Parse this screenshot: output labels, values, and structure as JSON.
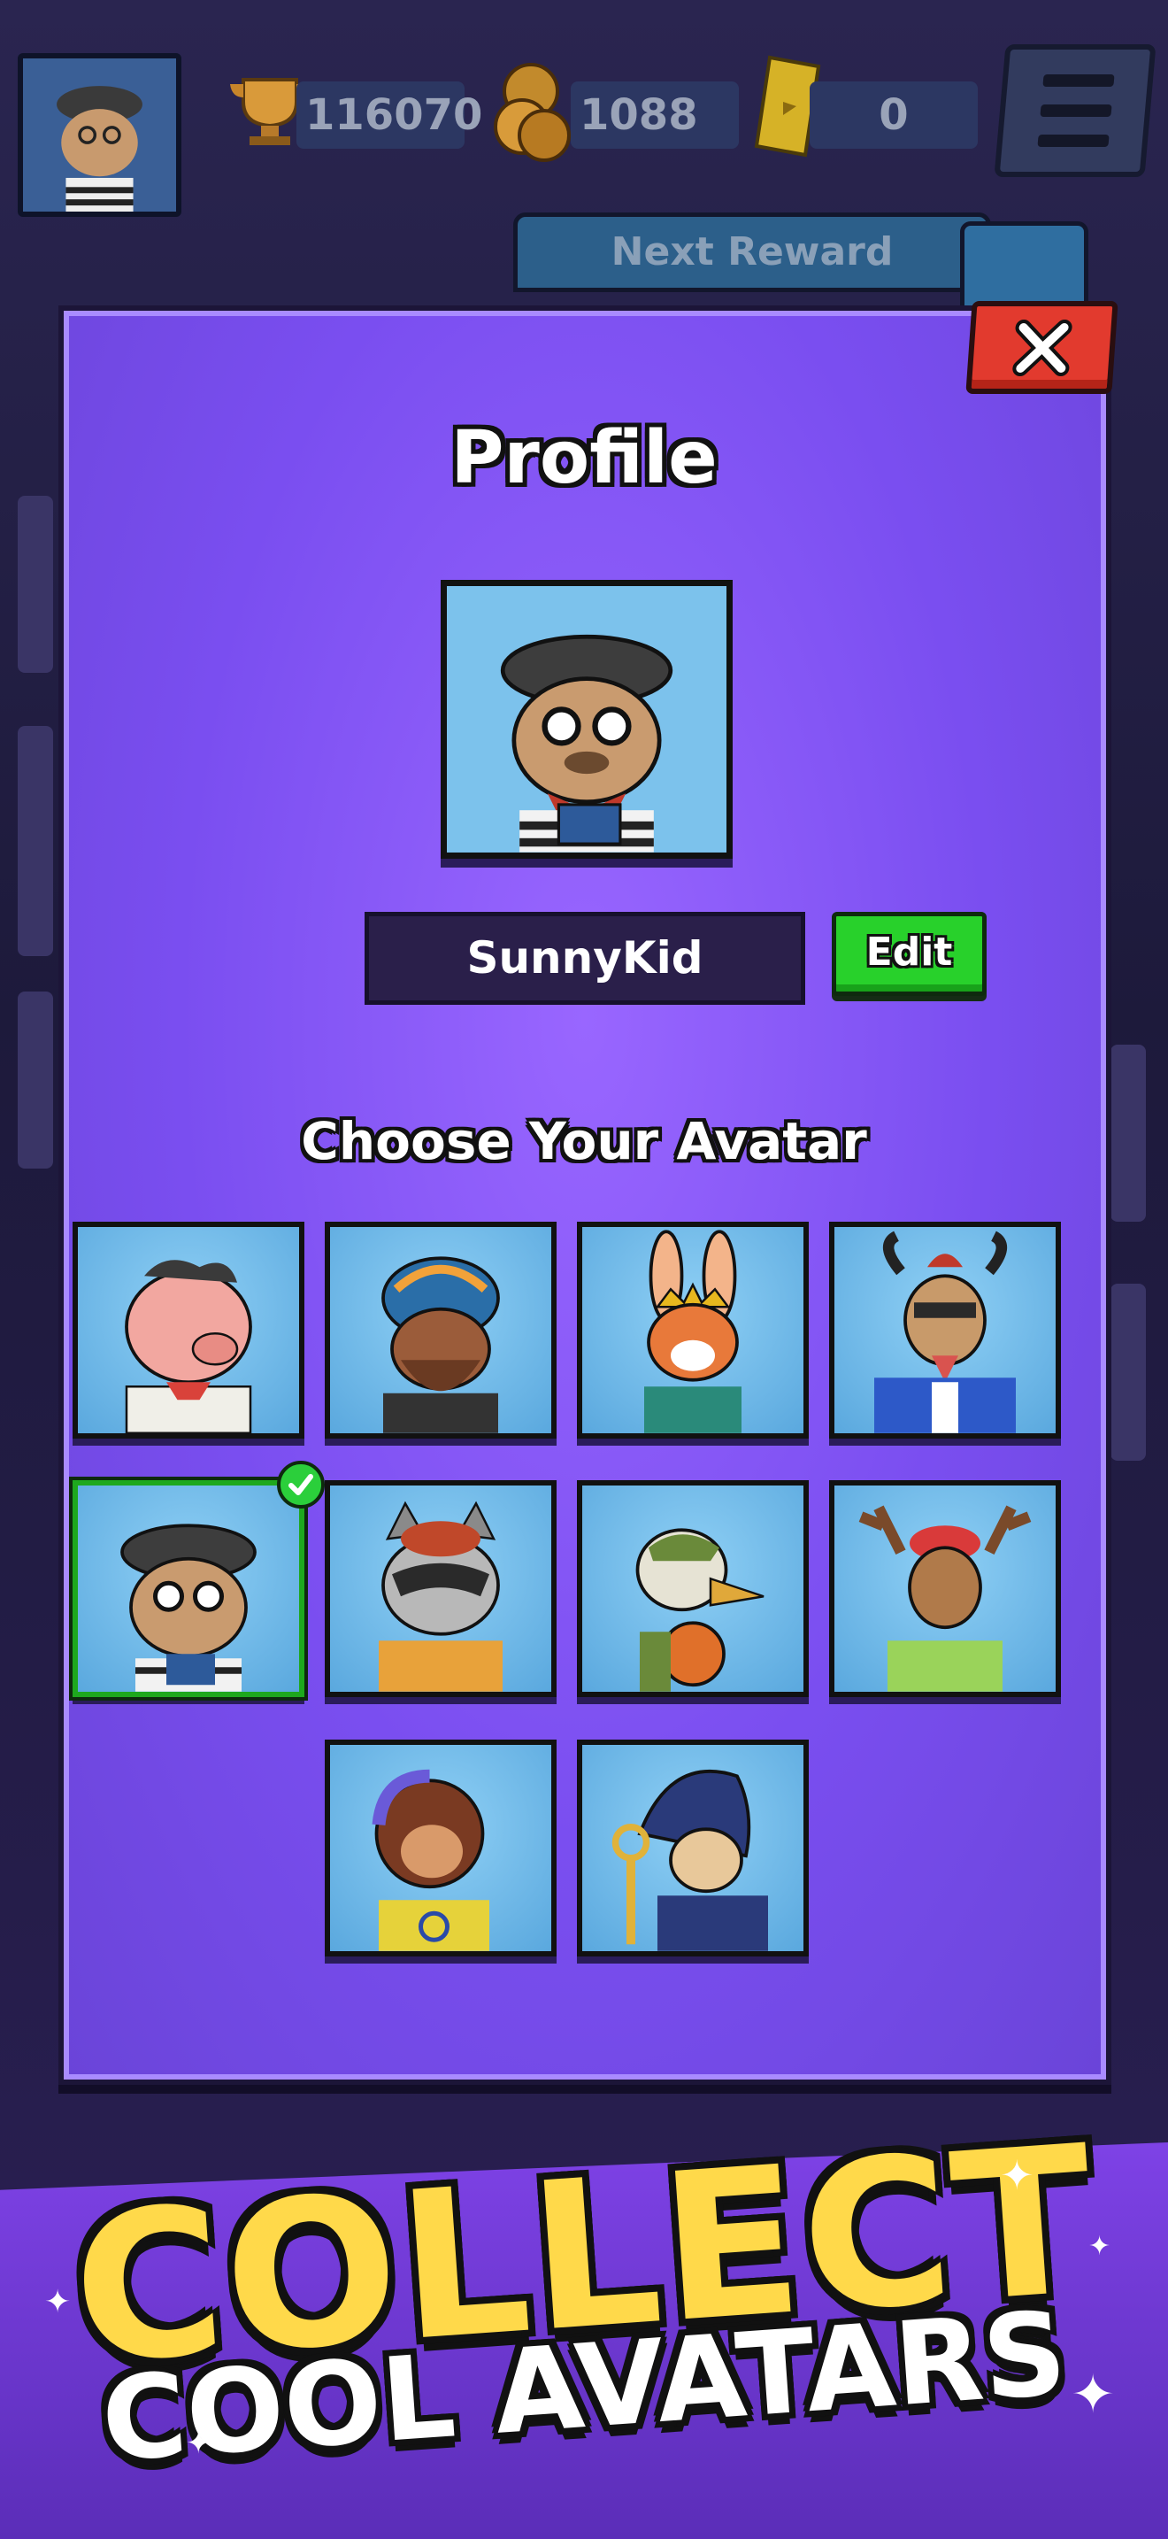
{
  "hud": {
    "trophies": "116070",
    "coins": "1088",
    "tickets": "0",
    "next_reward_label": "Next Reward"
  },
  "dialog": {
    "title": "Profile",
    "player_name": "SunnyKid",
    "edit_label": "Edit",
    "avatar_section_title": "Choose Your Avatar"
  },
  "avatars": [
    {
      "name": "pig",
      "icon": "pig-avatar-icon",
      "selected": false
    },
    {
      "name": "beaver-biker",
      "icon": "beaver-avatar-icon",
      "selected": false
    },
    {
      "name": "bunny-king",
      "icon": "bunny-avatar-icon",
      "selected": false
    },
    {
      "name": "goat-cool",
      "icon": "goat-avatar-icon",
      "selected": false
    },
    {
      "name": "bulldog",
      "icon": "bulldog-avatar-icon",
      "selected": true
    },
    {
      "name": "raccoon",
      "icon": "raccoon-avatar-icon",
      "selected": false
    },
    {
      "name": "duck",
      "icon": "duck-avatar-icon",
      "selected": false
    },
    {
      "name": "deer",
      "icon": "deer-avatar-icon",
      "selected": false
    },
    {
      "name": "monkey",
      "icon": "monkey-avatar-icon",
      "selected": false
    },
    {
      "name": "cat-wizard",
      "icon": "cat-avatar-icon",
      "selected": false
    }
  ],
  "banner": {
    "line1": "COLLECT",
    "line2": "COOL AVATARS"
  },
  "colors": {
    "dialog_purple": "#7a4ef0",
    "close_red": "#e23a2e",
    "edit_green": "#28d12b",
    "banner_yellow": "#ffd94a"
  }
}
